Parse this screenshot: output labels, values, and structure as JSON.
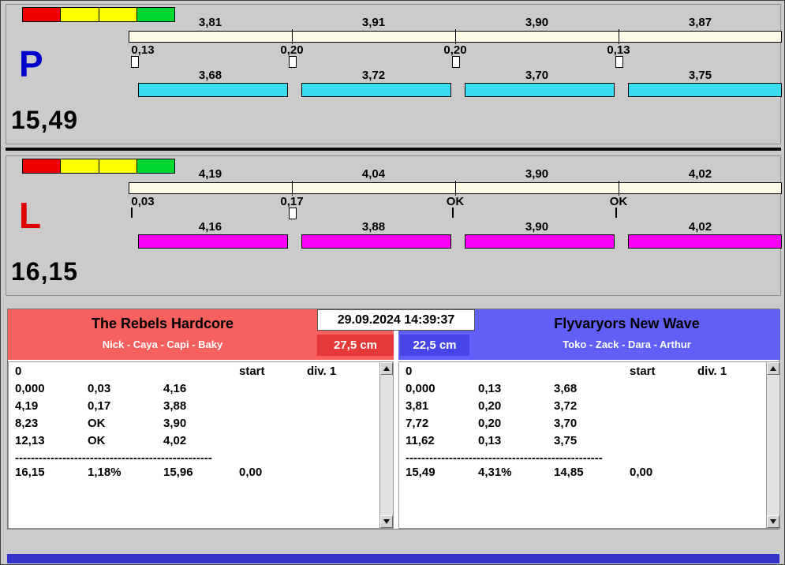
{
  "window": {
    "footer_color": "#3333cc"
  },
  "panels": [
    {
      "letter": "P",
      "letter_color": "#0000cc",
      "total": "15,49",
      "status_segments": [
        "#ee0000",
        "#ffff00",
        "#ffff00",
        "#00d830"
      ],
      "top_values": [
        "3,81",
        "3,91",
        "3,90",
        "3,87"
      ],
      "gap_values": [
        "0,13",
        "0,20",
        "0,20",
        "0,13"
      ],
      "gap_markers": [
        "box",
        "box",
        "box",
        "box"
      ],
      "lap_values": [
        "3,68",
        "3,72",
        "3,70",
        "3,75"
      ],
      "lap_bar_color": "#3cdcf0"
    },
    {
      "letter": "L",
      "letter_color": "#dd0000",
      "total": "16,15",
      "status_segments": [
        "#ee0000",
        "#ffff00",
        "#ffff00",
        "#00d830"
      ],
      "top_values": [
        "4,19",
        "4,04",
        "3,90",
        "4,02"
      ],
      "gap_values": [
        "0,03",
        "0,17",
        "OK",
        "OK"
      ],
      "gap_markers": [
        "tick",
        "box",
        "tick",
        "tick"
      ],
      "lap_values": [
        "4,16",
        "3,88",
        "3,90",
        "4,02"
      ],
      "lap_bar_color": "#f800f8"
    }
  ],
  "scoreboard": {
    "datetime": "29.09.2024 14:39:37",
    "teams": [
      {
        "name": "The Rebels Hardcore",
        "members": "Nick - Caya - Capi - Baky",
        "distance": "27,5 cm",
        "header_color": "#f86060",
        "badge_color": "#e63a3a"
      },
      {
        "name": "Flyvaryors New Wave",
        "members": "Toko - Zack - Dara - Arthur",
        "distance": "22,5 cm",
        "header_color": "#6060f8",
        "badge_color": "#4646e8"
      }
    ],
    "tables": [
      {
        "start_label": "0",
        "col_start": "start",
        "col_div": "div. 1",
        "rows": [
          [
            "0,000",
            "0,03",
            "4,16"
          ],
          [
            "4,19",
            "0,17",
            "3,88"
          ],
          [
            "8,23",
            "OK",
            "3,90"
          ],
          [
            "12,13",
            "OK",
            "4,02"
          ]
        ],
        "separator": "--------------------------------------------------",
        "totals": [
          "16,15",
          "1,18%",
          "15,96",
          "0,00"
        ]
      },
      {
        "start_label": "0",
        "col_start": "start",
        "col_div": "div. 1",
        "rows": [
          [
            "0,000",
            "0,13",
            "3,68"
          ],
          [
            "3,81",
            "0,20",
            "3,72"
          ],
          [
            "7,72",
            "0,20",
            "3,70"
          ],
          [
            "11,62",
            "0,13",
            "3,75"
          ]
        ],
        "separator": "--------------------------------------------------",
        "totals": [
          "15,49",
          "4,31%",
          "14,85",
          "0,00"
        ]
      }
    ]
  }
}
